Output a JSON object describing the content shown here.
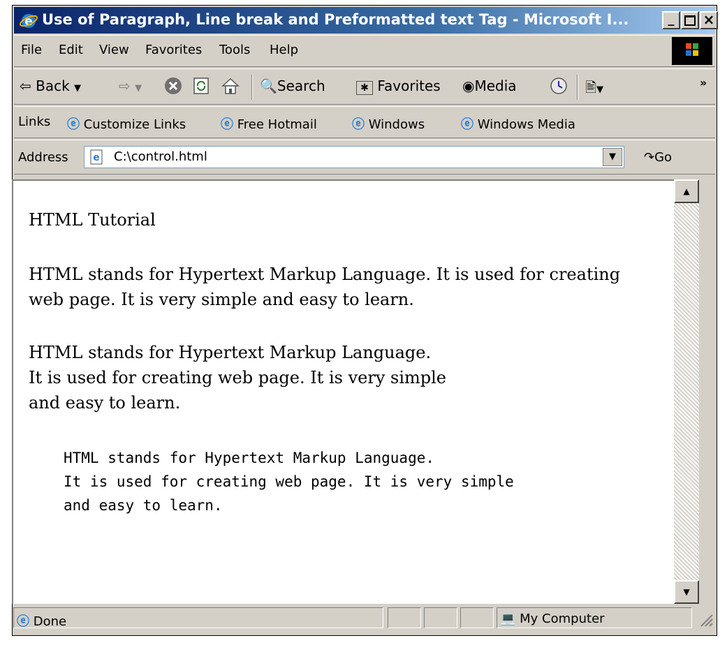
{
  "window": {
    "title": "Use of Paragraph, Line break and Preformatted text Tag - Microsoft I...",
    "minimize_icon": "minimize-icon",
    "maximize_icon": "maximize-icon",
    "close_icon": "close-icon"
  },
  "menu": [
    "File",
    "Edit",
    "View",
    "Favorites",
    "Tools",
    "Help"
  ],
  "toolbar": {
    "back": "Back",
    "search": "Search",
    "favorites": "Favorites",
    "media": "Media",
    "overflow": "»"
  },
  "links": {
    "label": "Links",
    "items": [
      "Customize Links",
      "Free Hotmail",
      "Windows",
      "Windows Media"
    ]
  },
  "address": {
    "label": "Address",
    "value": "C:\\control.html",
    "go": "Go"
  },
  "content": {
    "heading": "HTML Tutorial",
    "para1_line1": "HTML stands for Hypertext Markup Language. It is used for creating",
    "para1_line2": "web page. It is very simple and easy to learn.",
    "para2_line1": "HTML stands for Hypertext Markup Language.",
    "para2_line2": "It is used for creating web page. It is very simple",
    "para2_line3": "and easy to learn.",
    "pre_line1": "HTML stands for Hypertext Markup Language.",
    "pre_line2": "It is used for creating web page. It is very simple",
    "pre_line3": "and easy to learn."
  },
  "status": {
    "text": "Done",
    "zone": "My Computer"
  },
  "colors": {
    "titlebar": "#0a246a",
    "chrome": "#d4d0c8"
  }
}
